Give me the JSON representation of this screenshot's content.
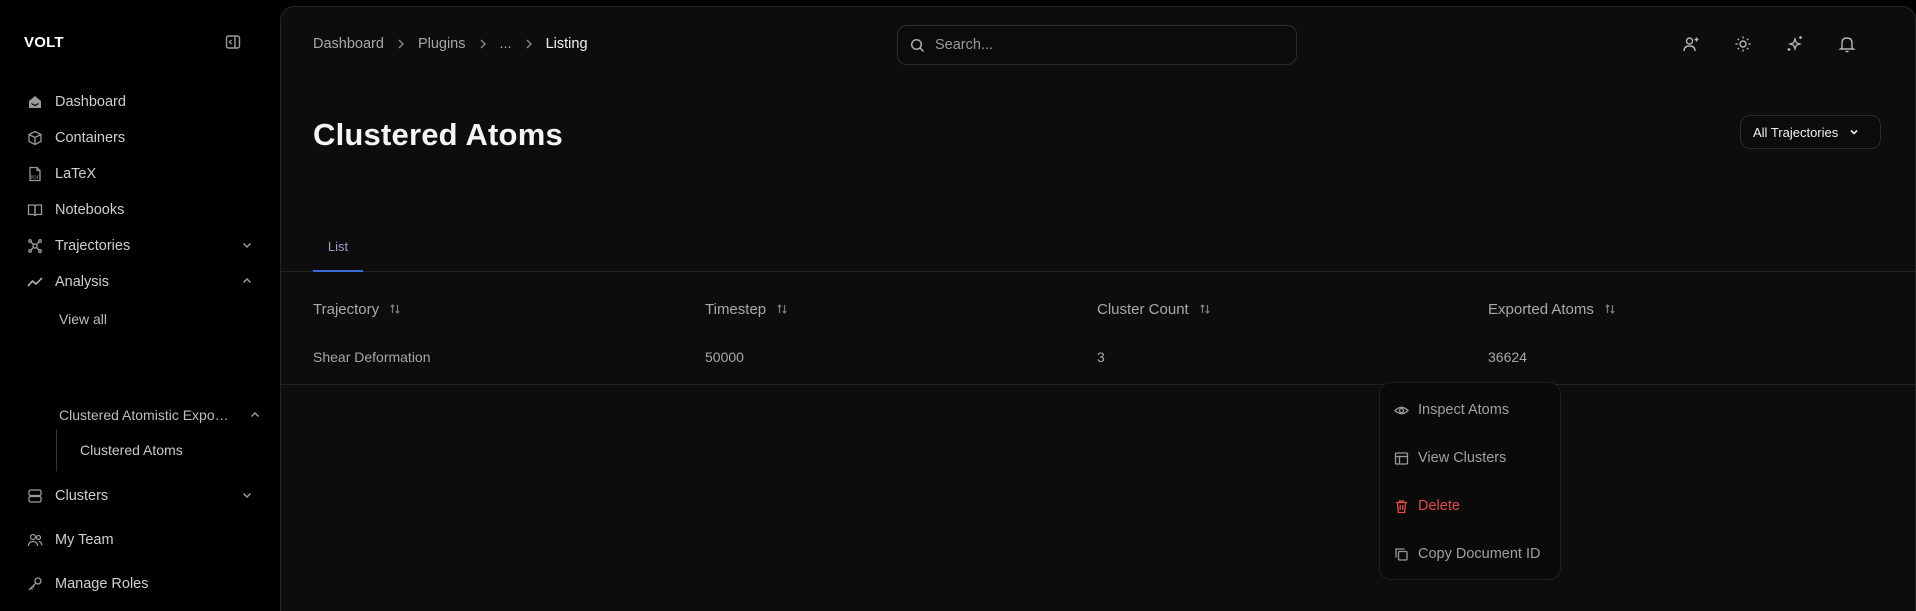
{
  "brand": "VOLT",
  "sidebar": {
    "items": [
      {
        "label": "Dashboard",
        "icon": "home-icon"
      },
      {
        "label": "Containers",
        "icon": "box-icon"
      },
      {
        "label": "LaTeX",
        "icon": "pdf-file-icon"
      },
      {
        "label": "Notebooks",
        "icon": "book-icon"
      },
      {
        "label": "Trajectories",
        "icon": "network-icon",
        "expanded": false
      },
      {
        "label": "Analysis",
        "icon": "trend-line-icon",
        "expanded": true
      },
      {
        "label": "Clusters",
        "icon": "server-icon",
        "expanded": false
      },
      {
        "label": "My Team",
        "icon": "users-icon"
      },
      {
        "label": "Manage Roles",
        "icon": "key-icon"
      }
    ],
    "analysis_sub": [
      {
        "label": "View all"
      },
      {
        "label": "Clustered Atomistic Expo…",
        "expanded": true
      }
    ],
    "analysis_subsub": [
      {
        "label": "Clustered Atoms"
      }
    ]
  },
  "breadcrumb": [
    "Dashboard",
    "Plugins",
    "...",
    "Listing"
  ],
  "search": {
    "placeholder": "Search..."
  },
  "top_icons": [
    "user-plus-icon",
    "sun-icon",
    "sparkles-icon",
    "bell-icon"
  ],
  "page": {
    "title": "Clustered Atoms",
    "trajectory_filter": "All Trajectories"
  },
  "tabs": [
    {
      "label": "List",
      "active": true
    }
  ],
  "table": {
    "columns": [
      "Trajectory",
      "Timestep",
      "Cluster Count",
      "Exported Atoms"
    ],
    "rows": [
      [
        "Shear Deformation",
        "50000",
        "3",
        "36624"
      ]
    ]
  },
  "context_menu": [
    {
      "label": "Inspect Atoms",
      "icon": "eye-icon"
    },
    {
      "label": "View Clusters",
      "icon": "table-icon"
    },
    {
      "label": "Delete",
      "icon": "trash-icon",
      "danger": true
    },
    {
      "label": "Copy Document ID",
      "icon": "copy-icon"
    }
  ],
  "colors": {
    "accent": "#3b6bd8",
    "danger": "#e24b4b",
    "background": "#000000",
    "panel": "#0d0d0d"
  }
}
